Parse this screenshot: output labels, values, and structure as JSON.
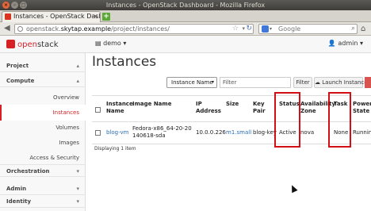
{
  "window": {
    "title": "Instances - OpenStack Dashboard - Mozilla Firefox"
  },
  "browser": {
    "tab_title": "Instances - OpenStack Dashbo...",
    "url_prefix": "openstack.",
    "url_host": "skytap.example",
    "url_path": "/project/instances/",
    "search_placeholder": "Google"
  },
  "header": {
    "brand_prefix": "open",
    "brand_suffix": "stack",
    "project": "demo",
    "user": "admin"
  },
  "sidebar": {
    "project": "Project",
    "compute": "Compute",
    "items": [
      "Overview",
      "Instances",
      "Volumes",
      "Images",
      "Access & Security"
    ],
    "orchestration": "Orchestration",
    "admin": "Admin",
    "identity": "Identity"
  },
  "main": {
    "title": "Instances",
    "filter_select": "Instance Name",
    "filter_placeholder": "Filter",
    "filter_button": "Filter",
    "launch_button": "Launch Instance",
    "footer": "Displaying 1 item"
  },
  "table": {
    "headers": {
      "name": "Instance Name",
      "image": "Image Name",
      "ip": "IP Address",
      "size": "Size",
      "keypair": "Key Pair",
      "status": "Status",
      "zone": "Availability Zone",
      "task": "Task",
      "power": "Power State"
    },
    "row": {
      "name": "blog-vm",
      "image": "Fedora-x86_64-20-20140618-sda",
      "ip": "10.0.0.226",
      "size": "m1.small",
      "keypair": "blog-key",
      "status": "Active",
      "zone": "nova",
      "task": "None",
      "power": "Running"
    }
  },
  "colors": {
    "accent": "#d71f26",
    "link": "#2a6ebb",
    "highlight": "#d10f15"
  }
}
